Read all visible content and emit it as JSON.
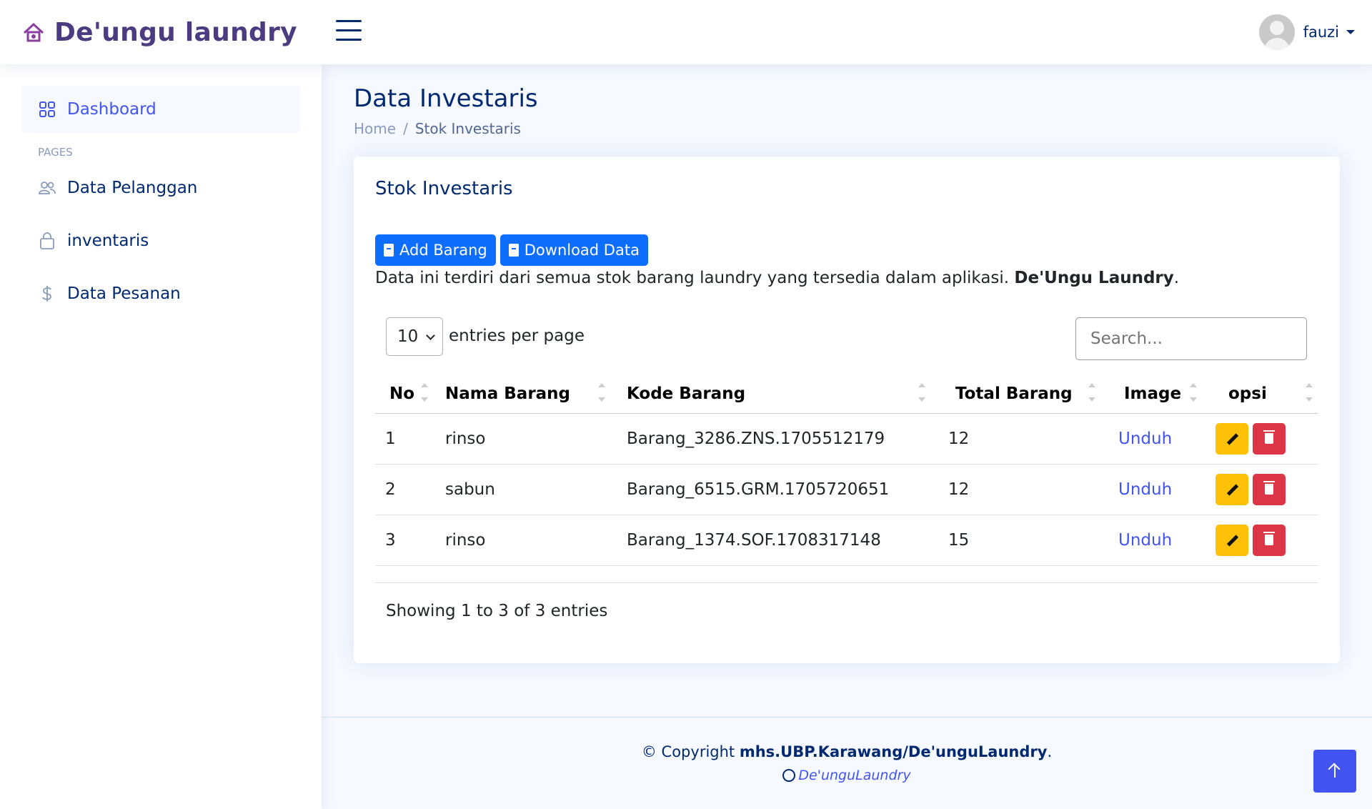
{
  "header": {
    "app_name": "De'ungu laundry",
    "user_name": "fauzi"
  },
  "sidebar": {
    "items": [
      {
        "label": "Dashboard",
        "icon": "grid-icon"
      },
      {
        "label": "Data Pelanggan",
        "icon": "people-icon"
      },
      {
        "label": "inventaris",
        "icon": "bag-icon"
      },
      {
        "label": "Data Pesanan",
        "icon": "dollar-icon"
      }
    ],
    "heading": "Pages"
  },
  "page": {
    "title": "Data Investaris",
    "breadcrumb": [
      "Home",
      "Stok Investaris"
    ]
  },
  "card": {
    "title": "Stok Investaris",
    "add_label": "Add Barang",
    "download_label": "Download Data",
    "desc_text": "Data ini terdiri dari semua stok barang laundry yang tersedia dalam aplikasi. ",
    "desc_brand": "De'Ungu Laundry",
    "desc_end": "."
  },
  "table": {
    "per_page": "10",
    "per_page_label": "entries per page",
    "search_placeholder": "Search...",
    "columns": [
      "No",
      "Nama Barang",
      "Kode Barang",
      "Total Barang",
      "Image",
      "opsi"
    ],
    "rows": [
      {
        "no": "1",
        "nama": "rinso",
        "kode": "Barang_3286.ZNS.1705512179",
        "total": "12",
        "image": "Unduh"
      },
      {
        "no": "2",
        "nama": "sabun",
        "kode": "Barang_6515.GRM.1705720651",
        "total": "12",
        "image": "Unduh"
      },
      {
        "no": "3",
        "nama": "rinso",
        "kode": "Barang_1374.SOF.1708317148",
        "total": "15",
        "image": "Unduh"
      }
    ],
    "showing": "Showing 1 to 3 of 3 entries"
  },
  "footer": {
    "copyright_prefix": "© Copyright ",
    "copyright_brand": "mhs.UBP.Karawang/De'unguLaundry",
    "copyright_suffix": ".",
    "credits": "De'unguLaundry"
  },
  "colors": {
    "primary": "#4154f1",
    "button": "#0d6efd",
    "warning": "#ffc107",
    "danger": "#dc3545",
    "brand": "#4b3b80"
  }
}
